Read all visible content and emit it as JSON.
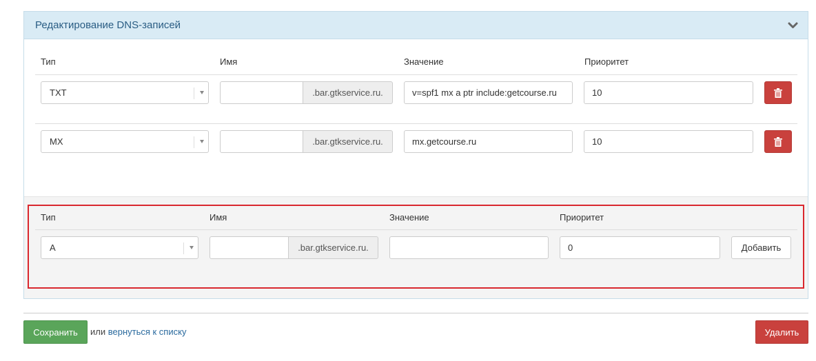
{
  "panel": {
    "title": "Редактирование DNS-записей",
    "collapse_icon": "chevron-down-icon"
  },
  "columns": {
    "type": "Тип",
    "name": "Имя",
    "value": "Значение",
    "priority": "Приоритет"
  },
  "records": [
    {
      "type": "TXT",
      "name": "",
      "domain_suffix": ".bar.gtkservice.ru.",
      "value": "v=spf1 mx a ptr include:getcourse.ru",
      "priority": "10",
      "delete_icon": "trash-icon"
    },
    {
      "type": "MX",
      "name": "",
      "domain_suffix": ".bar.gtkservice.ru.",
      "value": "mx.getcourse.ru",
      "priority": "10",
      "delete_icon": "trash-icon"
    }
  ],
  "new_record": {
    "type": "A",
    "name": "",
    "domain_suffix": ".bar.gtkservice.ru.",
    "value": "",
    "priority": "0",
    "add_label": "Добавить"
  },
  "footer": {
    "save_label": "Сохранить",
    "or_text": "или",
    "back_link": "вернуться к списку",
    "delete_label": "Удалить"
  },
  "colors": {
    "panel_heading_bg": "#d9ebf5",
    "danger": "#c9413d",
    "success": "#5aa55a",
    "highlight_border": "#d9272e",
    "link": "#2a6a9e"
  }
}
